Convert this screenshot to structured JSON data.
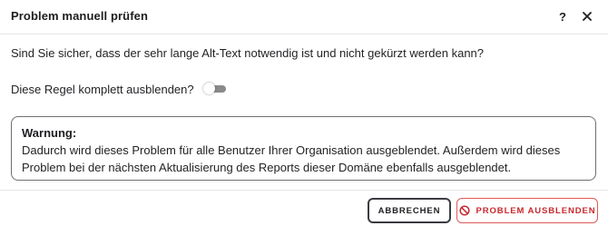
{
  "dialog": {
    "title": "Problem manuell prüfen",
    "help_label": "?",
    "question": "Sind Sie sicher, dass der sehr lange Alt-Text notwendig ist und nicht gekürzt werden kann?",
    "toggle": {
      "label": "Diese Regel komplett ausblenden?",
      "checked": false
    },
    "warning": {
      "title": "Warnung:",
      "text": "Dadurch wird dieses Problem für alle Benutzer Ihrer Organisation ausgeblendet. Außerdem wird dieses Problem bei der nächsten Aktualisierung des Reports dieser Domäne ebenfalls ausgeblendet."
    },
    "buttons": {
      "cancel_label": "ABBRECHEN",
      "hide_label": "PROBLEM AUSBLENDEN"
    }
  },
  "colors": {
    "danger": "#c8282d",
    "danger_border": "#e05a5a",
    "toggle_track": "#8a8a8a",
    "text": "#222326"
  },
  "icons": {
    "help": "question-mark",
    "close": "x-close",
    "hide": "ban-circle"
  }
}
